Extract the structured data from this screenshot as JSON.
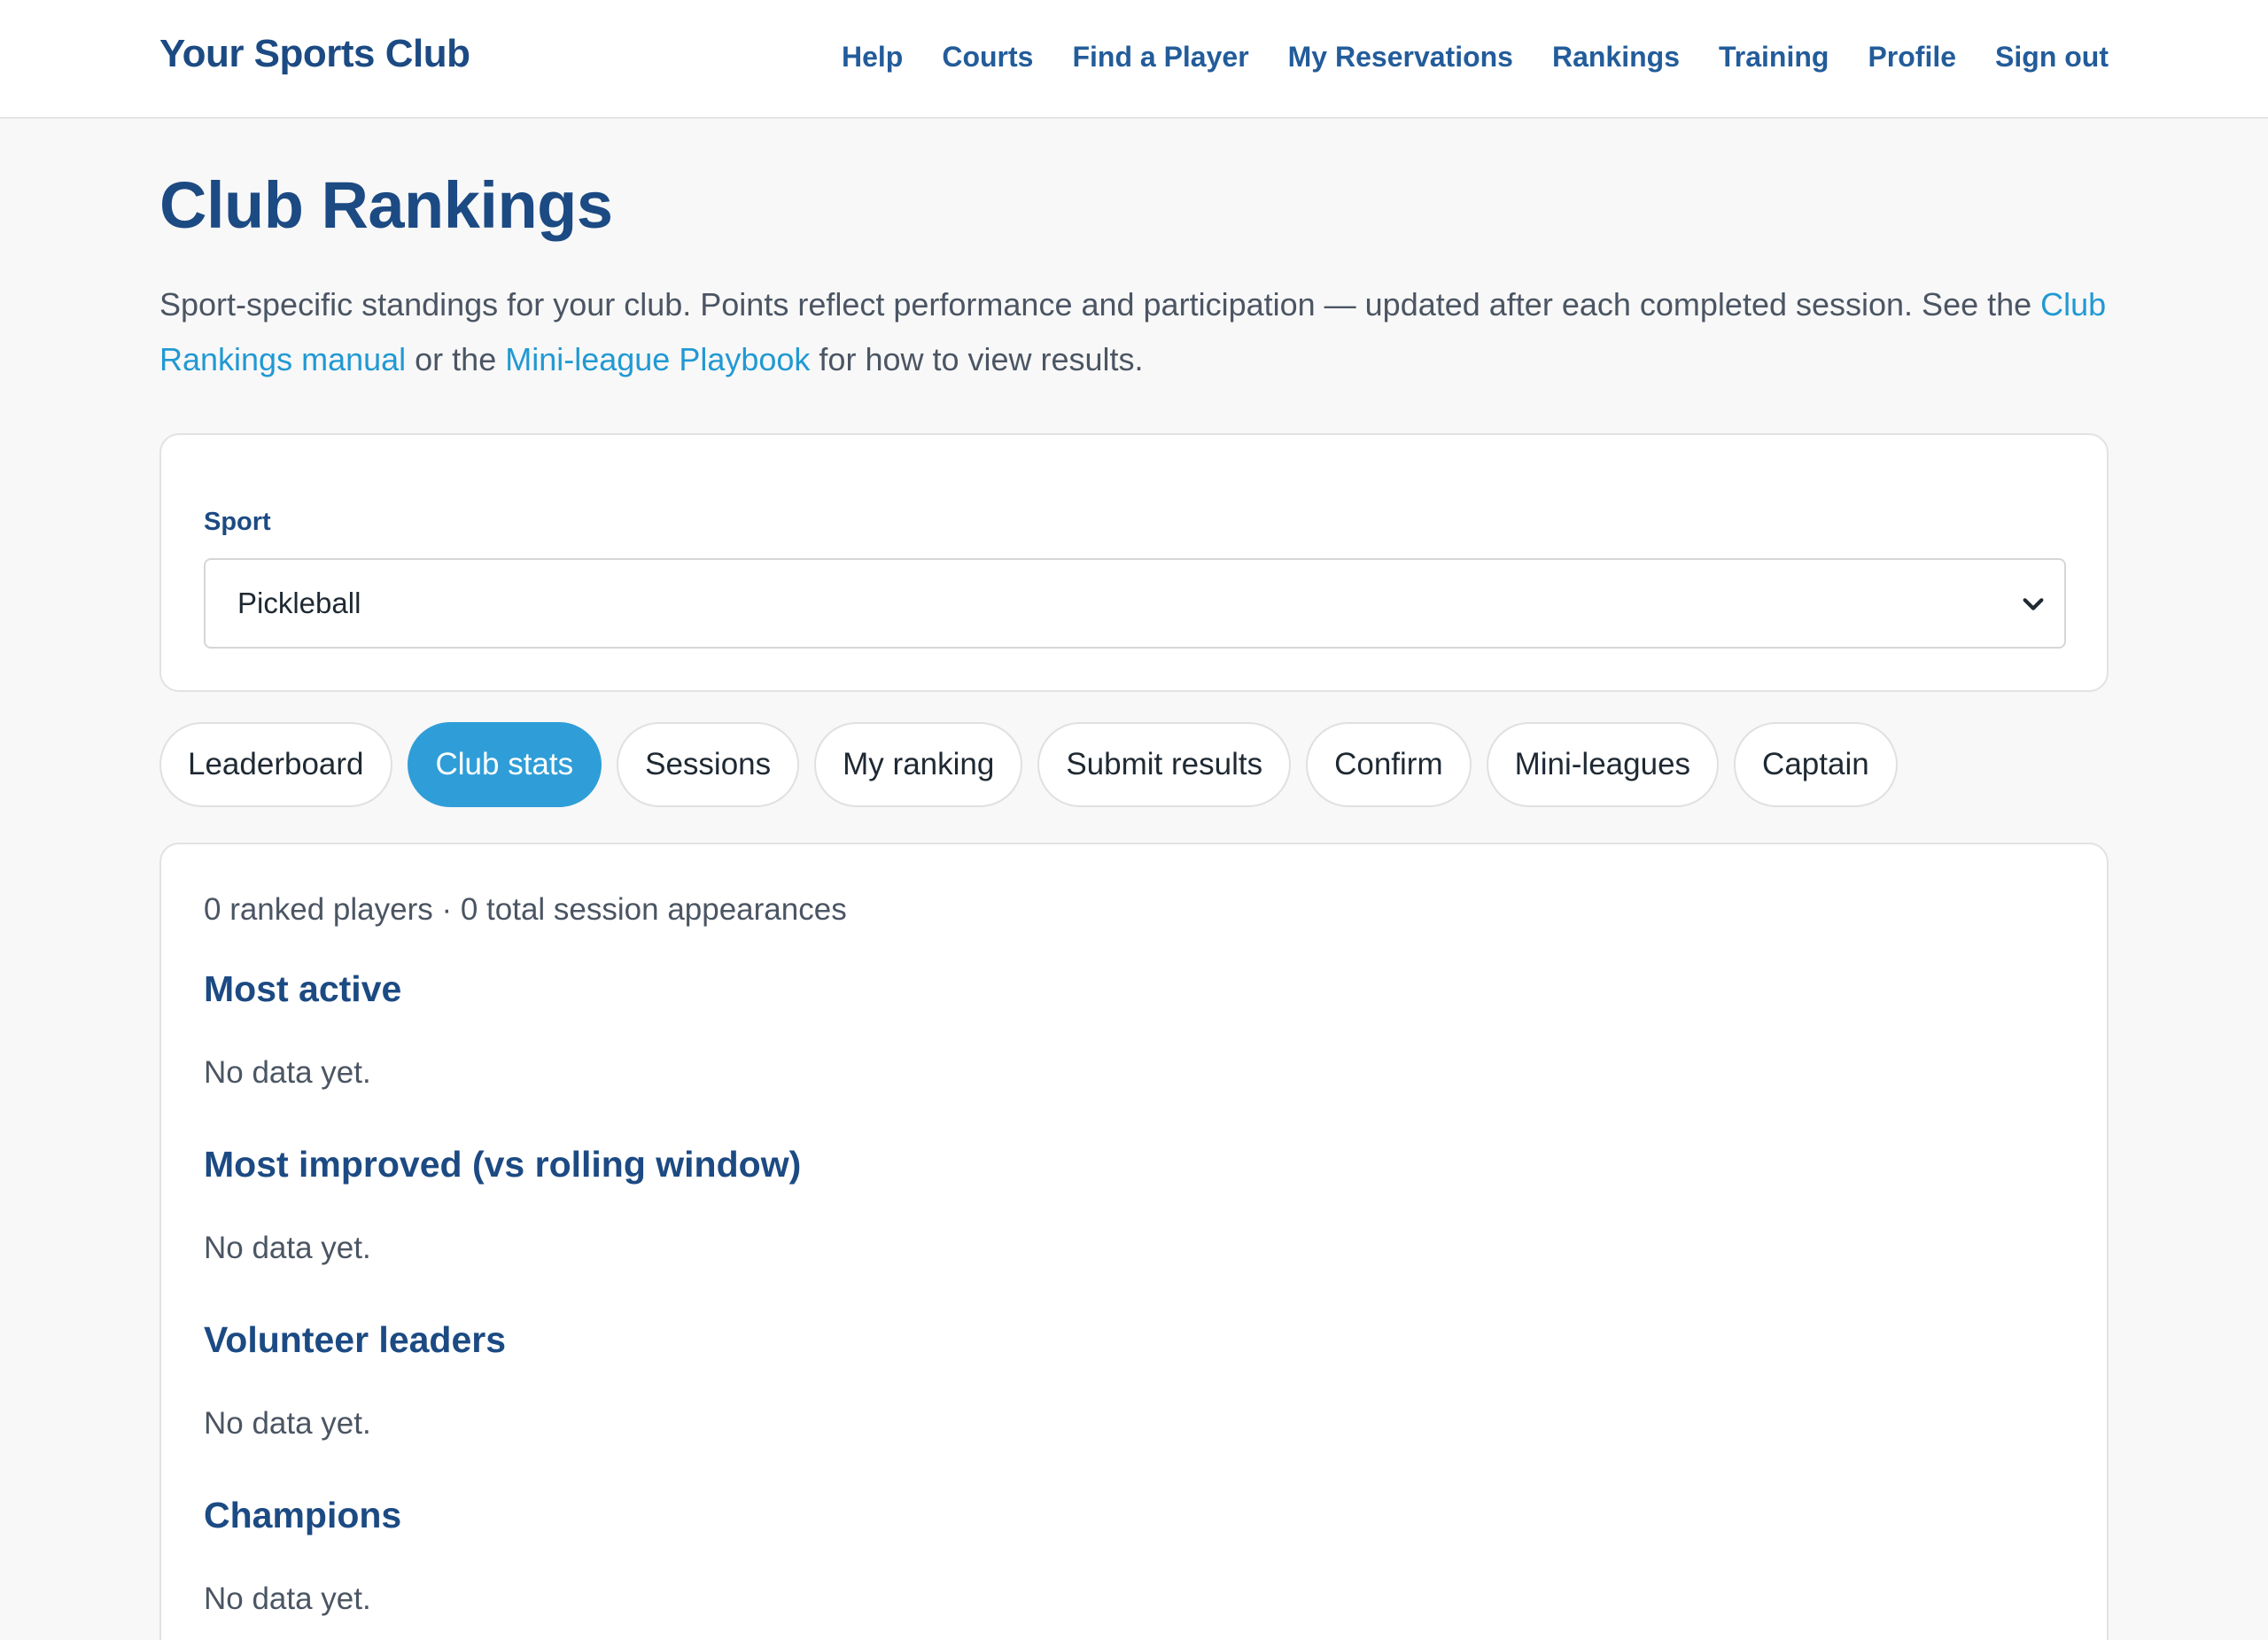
{
  "header": {
    "brand": "Your Sports Club",
    "nav": [
      {
        "label": "Help"
      },
      {
        "label": "Courts"
      },
      {
        "label": "Find a Player"
      },
      {
        "label": "My Reservations"
      },
      {
        "label": "Rankings"
      },
      {
        "label": "Training"
      },
      {
        "label": "Profile"
      },
      {
        "label": "Sign out"
      }
    ]
  },
  "page": {
    "title": "Club Rankings",
    "intro_text_1": "Sport-specific standings for your club. Points reflect performance and participation — updated after each completed session. See the ",
    "manual_link": "Club Rankings manual",
    "intro_text_2": " or the ",
    "playbook_link": "Mini-league Playbook",
    "intro_text_3": " for how to view results."
  },
  "sport_filter": {
    "label": "Sport",
    "selected": "Pickleball"
  },
  "tabs": [
    {
      "label": "Leaderboard",
      "active": false
    },
    {
      "label": "Club stats",
      "active": true
    },
    {
      "label": "Sessions",
      "active": false
    },
    {
      "label": "My ranking",
      "active": false
    },
    {
      "label": "Submit results",
      "active": false
    },
    {
      "label": "Confirm",
      "active": false
    },
    {
      "label": "Mini-leagues",
      "active": false
    },
    {
      "label": "Captain",
      "active": false
    }
  ],
  "stats": {
    "summary": "0 ranked players · 0 total session appearances",
    "sections": [
      {
        "title": "Most active",
        "empty": "No data yet."
      },
      {
        "title": "Most improved (vs rolling window)",
        "empty": "No data yet."
      },
      {
        "title": "Volunteer leaders",
        "empty": "No data yet."
      },
      {
        "title": "Champions",
        "empty": "No data yet."
      }
    ]
  },
  "colors": {
    "brand": "#1c4a83",
    "link": "#2199d3",
    "active_tab": "#2f9ed8"
  }
}
